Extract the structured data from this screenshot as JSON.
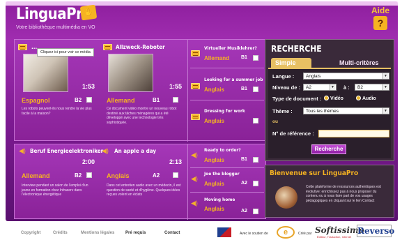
{
  "header": {
    "logo": "LinguaPro",
    "tagline": "Votre bibliothèque multimédia en VO",
    "help_label": "Aide",
    "help_icon": "?"
  },
  "tooltip": "Cliquez ici pour voir ce média",
  "videos": [
    {
      "title": "...",
      "duration": "1:53",
      "language": "Espagnol",
      "level": "B2",
      "description": "Les robots peuvent-ils nous rendre la vie plus facile à la maison?"
    },
    {
      "title": "Allzweck-Roboter",
      "duration": "1:55",
      "language": "Allemand",
      "level": "B1",
      "description": "Ce document vidéo montre un nouveau robot destiné aux tâches ménagères qui a été développé avec une technologie très sophistiquée."
    }
  ],
  "side_videos": [
    {
      "title": "Virtueller Musiklehrer?",
      "language": "Allemand",
      "level": "B1"
    },
    {
      "title": "Looking for a summer job",
      "language": "Anglais",
      "level": "B1"
    },
    {
      "title": "Dressing for work",
      "language": "Anglais",
      "level": "B1"
    }
  ],
  "audios": [
    {
      "title": "Beruf Energieelektroniker",
      "duration": "2:00",
      "language": "Allemand",
      "level": "B2",
      "description": "Interview pendant un salon de l'emploi d'un jeune en formation chez Infraserv dans l'électronique énergétique"
    },
    {
      "title": "An apple a day",
      "duration": "2:13",
      "language": "Anglais",
      "level": "A2",
      "description": "Dans cet entretien audio avec un médecin, il est question de santé et d'hygiène. Quelques idées reçues volent en éclats"
    }
  ],
  "side_audios": [
    {
      "title": "Ready to order?",
      "language": "Anglais",
      "level": "B1"
    },
    {
      "title": "Joe the blogger",
      "language": "Anglais",
      "level": "A2"
    },
    {
      "title": "Moving home",
      "language": "Anglais",
      "level": "A2"
    }
  ],
  "search": {
    "title": "RECHERCHE",
    "tab_simple": "Simple",
    "tab_multi": "Multi-critères",
    "langue_label": "Langue :",
    "langue_value": "Anglais",
    "niveau_label": "Niveau de :",
    "niveau_from": "A2",
    "niveau_to_label": "à :",
    "niveau_to": "B2",
    "type_label": "Type de document :",
    "type_video": "Vidéo",
    "type_audio": "Audio",
    "theme_label": "Thème :",
    "theme_value": "Tous les thèmes",
    "ou": "ou",
    "ref_label": "N° de référence :",
    "button": "Recherche"
  },
  "welcome": {
    "title": "Bienvenue sur LinguaPro",
    "text": "Cette plateforme de ressources authentiques est évolutive: enrichissez pas à nous proposer du contenu ou à nous faire part de vos usages pédagogiques en cliquant sur le lien Contact"
  },
  "footer": {
    "links": [
      "Copyright",
      "Crédits",
      "Mentions légales",
      "Pré requis",
      "Contact"
    ],
    "support": "Avec le soutien de",
    "created_by": "Créé par",
    "softissimo": "Softissimo",
    "softissimo_sub": "Éditeur, Traduction, Internet",
    "reverso": "Reverso"
  }
}
